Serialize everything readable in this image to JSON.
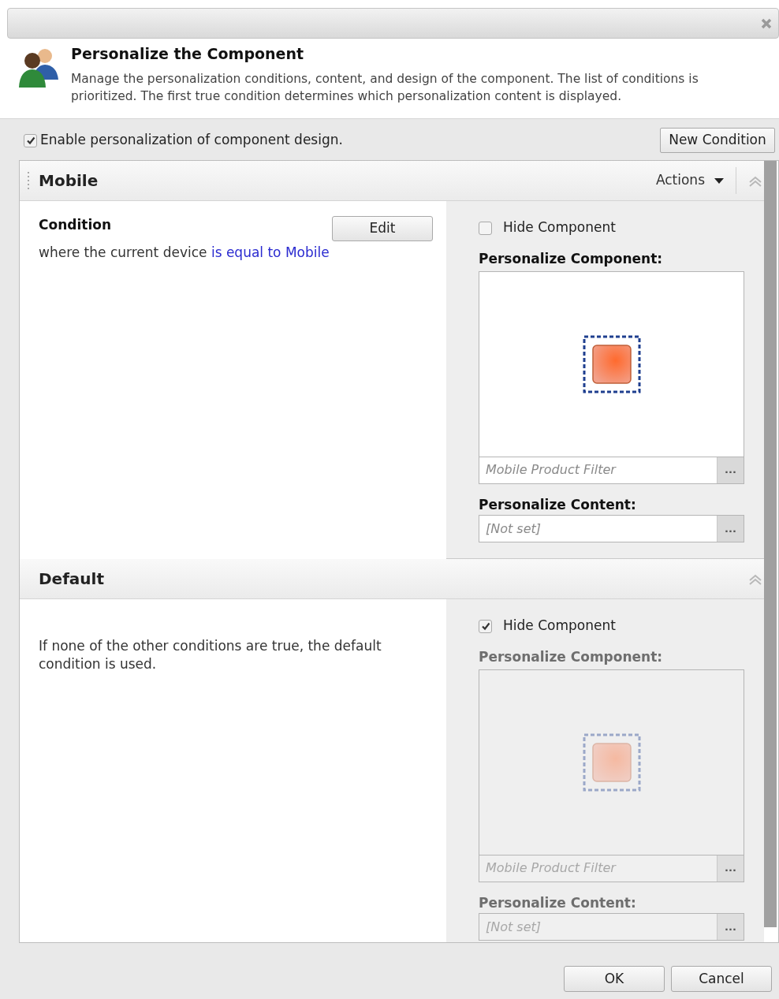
{
  "dialog": {
    "title": "Personalize the Component",
    "description": "Manage the personalization conditions, content, and design of the component. The list of conditions is prioritized. The first true condition determines which personalization content is displayed."
  },
  "enable": {
    "label": "Enable personalization of component design.",
    "checked": true
  },
  "new_condition": "New Condition",
  "conditions": [
    {
      "kind": "rule",
      "name": "Mobile",
      "actions": "Actions",
      "heading": "Condition",
      "edit": "Edit",
      "text": "where the current device",
      "link": "is equal to Mobile",
      "hide": {
        "label": "Hide Component",
        "checked": false
      },
      "component_label": "Personalize Component:",
      "component_value": "Mobile Product Filter",
      "content_label": "Personalize Content:",
      "content_value": "[Not set]",
      "browse": "...",
      "browse_content": "..."
    },
    {
      "kind": "default",
      "name": "Default",
      "text": "If none of the other conditions are true, the default condition is used.",
      "hide": {
        "label": "Hide Component",
        "checked": true
      },
      "component_label": "Personalize Component:",
      "component_value": "Mobile Product Filter",
      "content_label": "Personalize Content:",
      "content_value": "[Not set]",
      "browse": "...",
      "browse_content": "..."
    }
  ],
  "buttons": [
    "OK",
    "Cancel"
  ]
}
